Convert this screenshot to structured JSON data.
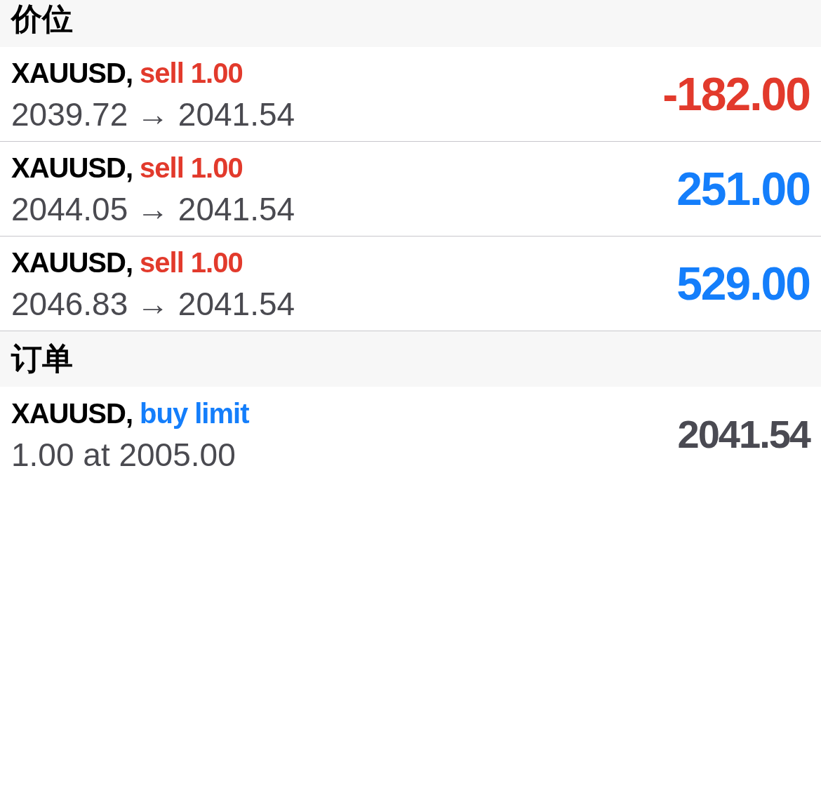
{
  "sections": [
    {
      "title": "价位",
      "items": [
        {
          "symbol": "XAUUSD,",
          "action": {
            "text": "sell 1.00",
            "color": "#e23a2c"
          },
          "detail": "2039.72 → 2041.54",
          "value": {
            "text": "-182.00",
            "color": "#e23a2c"
          }
        },
        {
          "symbol": "XAUUSD,",
          "action": {
            "text": "sell 1.00",
            "color": "#e23a2c"
          },
          "detail": "2044.05 → 2041.54",
          "value": {
            "text": "251.00",
            "color": "#147efb"
          }
        },
        {
          "symbol": "XAUUSD,",
          "action": {
            "text": "sell 1.00",
            "color": "#e23a2c"
          },
          "detail": "2046.83 → 2041.54",
          "value": {
            "text": "529.00",
            "color": "#147efb"
          }
        }
      ]
    },
    {
      "title": "订单",
      "items": [
        {
          "symbol": "XAUUSD,",
          "action": {
            "text": "buy limit",
            "color": "#147efb"
          },
          "detail": "1.00 at 2005.00",
          "value": {
            "text": "2041.54",
            "color": "#4a4a52"
          }
        }
      ]
    }
  ]
}
